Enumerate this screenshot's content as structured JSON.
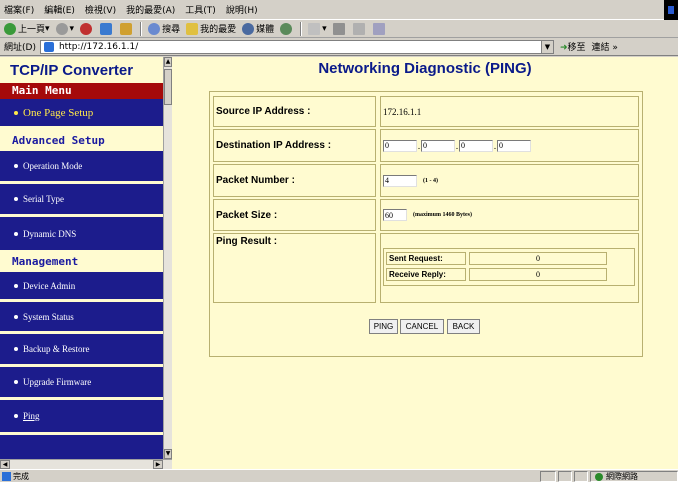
{
  "browser": {
    "menu": [
      "檔案(F)",
      "編輯(E)",
      "檢視(V)",
      "我的最愛(A)",
      "工具(T)",
      "說明(H)"
    ],
    "toolbar": {
      "back": "上一頁",
      "search": "搜尋",
      "favorites": "我的最愛",
      "media": "媒體"
    },
    "address_label": "網址(D)",
    "address_value": "http://172.16.1.1/",
    "go_label": "移至",
    "links_label": "連結 »",
    "status_text": "完成",
    "zone_text": "網際網路"
  },
  "sidebar": {
    "brand": "TCP/IP Converter",
    "main_menu": "Main Menu",
    "one_page_setup": "One Page Setup",
    "advanced_setup": "Advanced Setup",
    "advanced_items": [
      "Operation Mode",
      "Serial Type",
      "Dynamic DNS"
    ],
    "management": "Management",
    "management_items": [
      "Device Admin",
      "System Status",
      "Backup & Restore",
      "Upgrade Firmware",
      "Ping"
    ]
  },
  "main": {
    "title": "Networking Diagnostic (PING)",
    "source_label": "Source IP Address :",
    "source_value": "172.16.1.1",
    "dest_label": "Destination IP Address :",
    "dest_octets": [
      "0",
      "0",
      "0",
      "0"
    ],
    "packet_number_label": "Packet Number :",
    "packet_number_value": "4",
    "packet_number_hint": "(1 - 4)",
    "packet_size_label": "Packet Size :",
    "packet_size_value": "60",
    "packet_size_hint": "(maximum 1460 Bytes)",
    "ping_result_label": "Ping Result :",
    "sent_label": "Sent Request:",
    "sent_value": "0",
    "recv_label": "Receive Reply:",
    "recv_value": "0",
    "buttons": {
      "ping": "PING",
      "cancel": "CANCEL",
      "back": "BACK"
    }
  },
  "colors": {
    "nav_bg": "#1c1c8c",
    "cream": "#fffbd0",
    "title_blue": "#0a1a8a",
    "main_menu_red": "#a50a0a",
    "highlight_yellow": "#ffe84a"
  }
}
